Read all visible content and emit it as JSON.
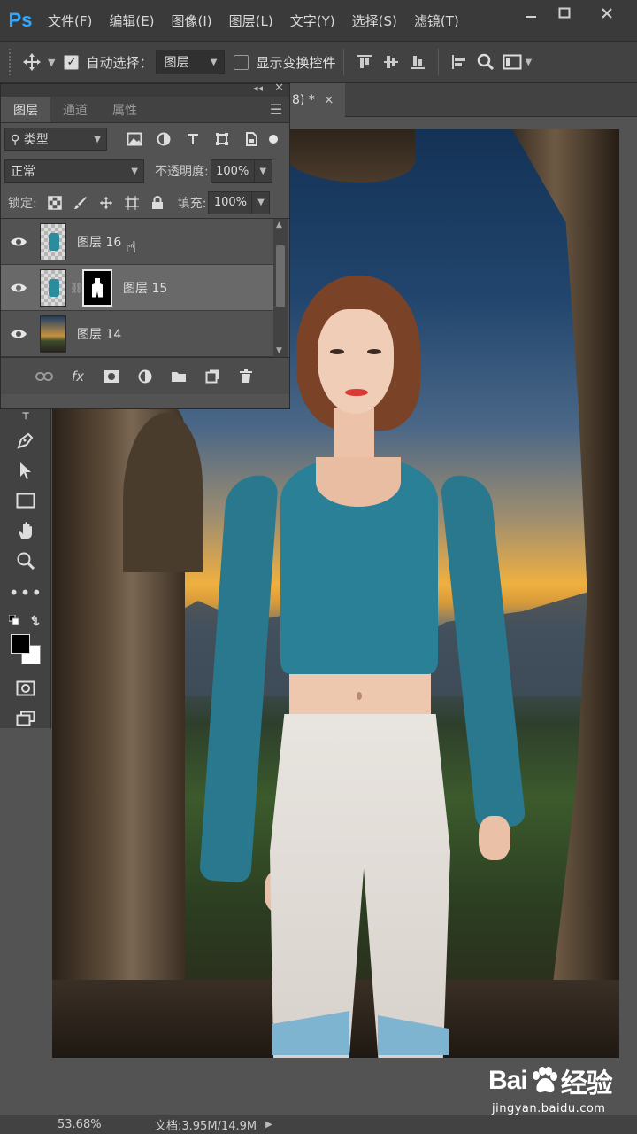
{
  "app": {
    "logo": "Ps",
    "menu": [
      "文件(F)",
      "编辑(E)",
      "图像(I)",
      "图层(L)",
      "文字(Y)",
      "选择(S)",
      "滤镜(T)"
    ],
    "window_controls": [
      "minimize-icon",
      "maximize-icon",
      "close-icon"
    ]
  },
  "options_bar": {
    "auto_select_label": "自动选择：",
    "auto_select_checked": true,
    "auto_select_value": "图层",
    "show_transform_label": "显示变换控件",
    "show_transform_checked": false
  },
  "layers_panel": {
    "tabs": [
      {
        "label": "图层",
        "active": true
      },
      {
        "label": "通道",
        "active": false
      },
      {
        "label": "属性",
        "active": false
      }
    ],
    "filter_type": "类型",
    "blend_mode": "正常",
    "opacity_label": "不透明度:",
    "opacity_value": "100%",
    "lock_label": "锁定:",
    "fill_label": "填充:",
    "fill_value": "100%",
    "layers": [
      {
        "name": "图层 16",
        "visible": true,
        "selected": false,
        "has_mask": false
      },
      {
        "name": "图层 15",
        "visible": true,
        "selected": true,
        "has_mask": true
      },
      {
        "name": "图层 14",
        "visible": true,
        "selected": false,
        "has_mask": false
      }
    ],
    "bottom_actions": [
      "link-icon",
      "fx",
      "mask-icon",
      "adjustment-icon",
      "folder-icon",
      "new-layer-icon",
      "trash-icon"
    ],
    "fx_label": "fx"
  },
  "document": {
    "tab_fragment": "8) *",
    "close_glyph": "×"
  },
  "status_bar": {
    "zoom": "53.68%",
    "doc_info": "文档:3.95M/14.9M"
  },
  "watermark": {
    "brand_left": "Bai",
    "brand_right": "经验",
    "url": "jingyan.baidu.com"
  },
  "colors": {
    "ps_blue": "#31a8ff",
    "panel_bg": "#535353",
    "menubar_bg": "#3a3a3a",
    "selected_layer": "#696969"
  }
}
